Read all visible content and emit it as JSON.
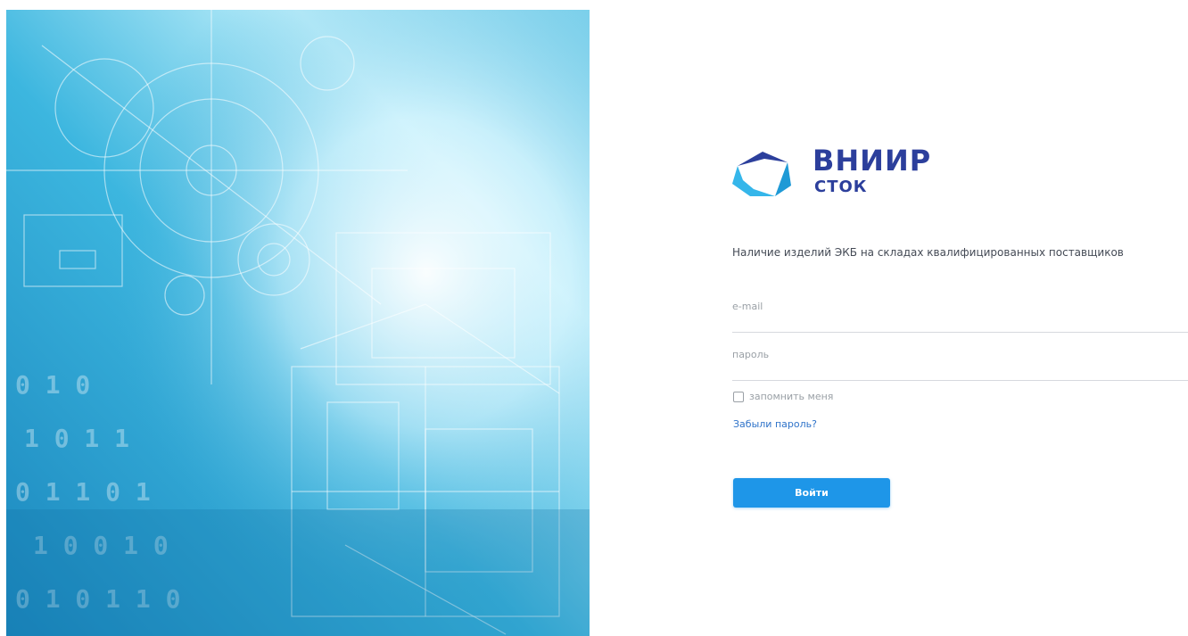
{
  "hero": {
    "image_name": "engineering-blueprint-background",
    "colors": {
      "primary": "#3fb3d9",
      "light": "#e8fbff",
      "deep": "#1b7fb3"
    }
  },
  "brand": {
    "logo_icon": "vniir-logo-icon",
    "title": "ВНИИР",
    "subtitle": "СТОК",
    "color": "#2c3f9c",
    "accent": "#1f9ad6"
  },
  "login": {
    "tagline": "Наличие изделий ЭКБ на складах квалифицированных поставщиков",
    "email_placeholder": "e-mail",
    "password_placeholder": "пароль",
    "remember_label": "запомнить меня",
    "forgot_label": "Забыли пароль?",
    "submit_label": "Войти",
    "button_color": "#1e96e8",
    "link_color": "#2f73c9"
  }
}
